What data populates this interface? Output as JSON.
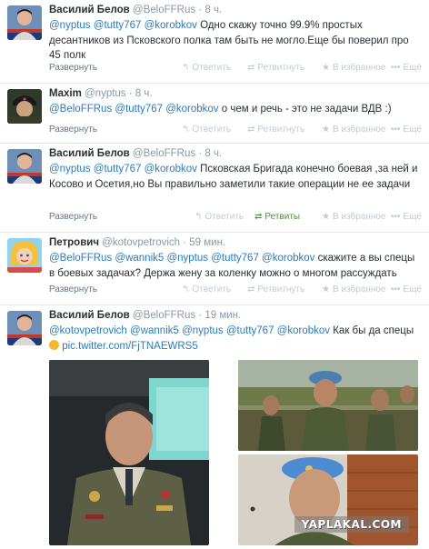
{
  "tweets": [
    {
      "name": "Василий Белов",
      "handle": "@BeloFFRus",
      "time": "· 8 ч.",
      "mentions": [
        "@nyptus",
        "@tutty767",
        "@korobkov"
      ],
      "text": "Одно скажу точно 99.9% простых десантников из Псковского полка там быть не могло.Еще бы поверил про 45 полк",
      "expand": "Развернуть",
      "reply": "Ответить",
      "retweet": "Ретвитнуть",
      "favorite": "В избранное",
      "more": "Ещё"
    },
    {
      "name": "Maxim",
      "handle": "@nyptus",
      "time": "· 8 ч.",
      "mentions": [
        "@BeloFFRus",
        "@tutty767",
        "@korobkov"
      ],
      "text": "о чем и речь - это не задачи ВДВ :)",
      "expand": "Развернуть",
      "reply": "Ответить",
      "retweet": "Ретвитнуть",
      "favorite": "В избранное",
      "more": "Ещё"
    },
    {
      "name": "Василий Белов",
      "handle": "@BeloFFRus",
      "time": "· 8 ч.",
      "mentions": [
        "@nyptus",
        "@tutty767",
        "@korobkov"
      ],
      "text": "Псковская Бригада конечно боевая ,за ней и Косово и Осетия,но Вы правильно заметили такие операции не ее задачи",
      "expand": "Развернуть",
      "reply": "Ответить",
      "retweet": "Ретвиты",
      "favorite": "В избранное",
      "more": "Ещё"
    },
    {
      "name": "Петрович",
      "handle": "@kotovpetrovich",
      "time": "· 59 мин.",
      "mentions": [
        "@BeloFFRus",
        "@wannik5",
        "@nyptus",
        "@tutty767",
        "@korobkov"
      ],
      "text": "скажите а вы спецы в боевых задачах? Держа жену за коленку можно  о многом рассуждать",
      "expand": "Развернуть",
      "reply": "Ответить",
      "retweet": "Ретвитнуть",
      "favorite": "В избранное",
      "more": "Ещё"
    },
    {
      "name": "Василий Белов",
      "handle": "@BeloFFRus",
      "time": "· 19 мин.",
      "mentions": [
        "@kotovpetrovich",
        "@wannik5",
        "@nyptus",
        "@tutty767",
        "@korobkov"
      ],
      "text": "Как бы да спецы",
      "link": "pic.twitter.com/FjTNAEWRS5"
    }
  ],
  "watermark": "YAPLAKAL.COM",
  "colors": {
    "mention": "#2b7bb9",
    "retweeted": "#4a8f3a",
    "muted": "#8899a6"
  }
}
